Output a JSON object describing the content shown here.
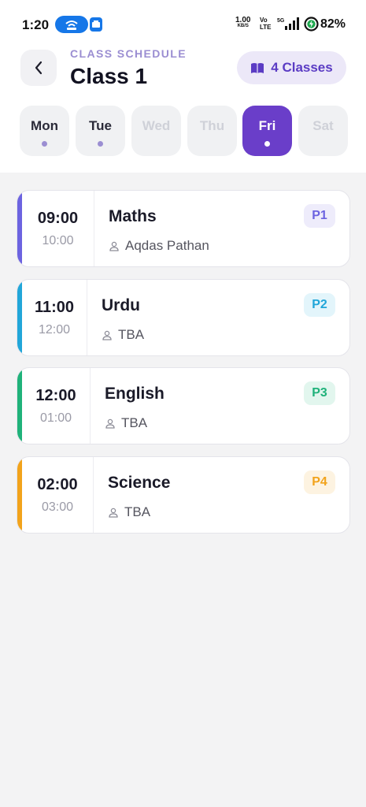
{
  "status_bar": {
    "time": "1:20",
    "speed": "1.00",
    "speed_unit": "KB/S",
    "volte_top": "Vo",
    "volte_bottom": "LTE",
    "battery": "82%"
  },
  "header": {
    "subtitle": "CLASS SCHEDULE",
    "title": "Class 1",
    "classes_badge": "4 Classes"
  },
  "days": [
    {
      "label": "Mon",
      "has_classes": true,
      "active": false
    },
    {
      "label": "Tue",
      "has_classes": true,
      "active": false
    },
    {
      "label": "Wed",
      "has_classes": false,
      "active": false
    },
    {
      "label": "Thu",
      "has_classes": false,
      "active": false
    },
    {
      "label": "Fri",
      "has_classes": true,
      "active": true
    },
    {
      "label": "Sat",
      "has_classes": false,
      "active": false
    }
  ],
  "classes": [
    {
      "start": "09:00",
      "end": "10:00",
      "subject": "Maths",
      "teacher": "Aqdas Pathan",
      "period": "P1",
      "accent": "#6c63e0",
      "badge_bg": "#eeecfb",
      "badge_fg": "#6c63e0"
    },
    {
      "start": "11:00",
      "end": "12:00",
      "subject": "Urdu",
      "teacher": "TBA",
      "period": "P2",
      "accent": "#21a6d9",
      "badge_bg": "#e3f5fb",
      "badge_fg": "#21a6d9"
    },
    {
      "start": "12:00",
      "end": "01:00",
      "subject": "English",
      "teacher": "TBA",
      "period": "P3",
      "accent": "#1fb27a",
      "badge_bg": "#e2f6ee",
      "badge_fg": "#1fb27a"
    },
    {
      "start": "02:00",
      "end": "03:00",
      "subject": "Science",
      "teacher": "TBA",
      "period": "P4",
      "accent": "#f2a31b",
      "badge_bg": "#fdf3e1",
      "badge_fg": "#f2a31b"
    }
  ]
}
